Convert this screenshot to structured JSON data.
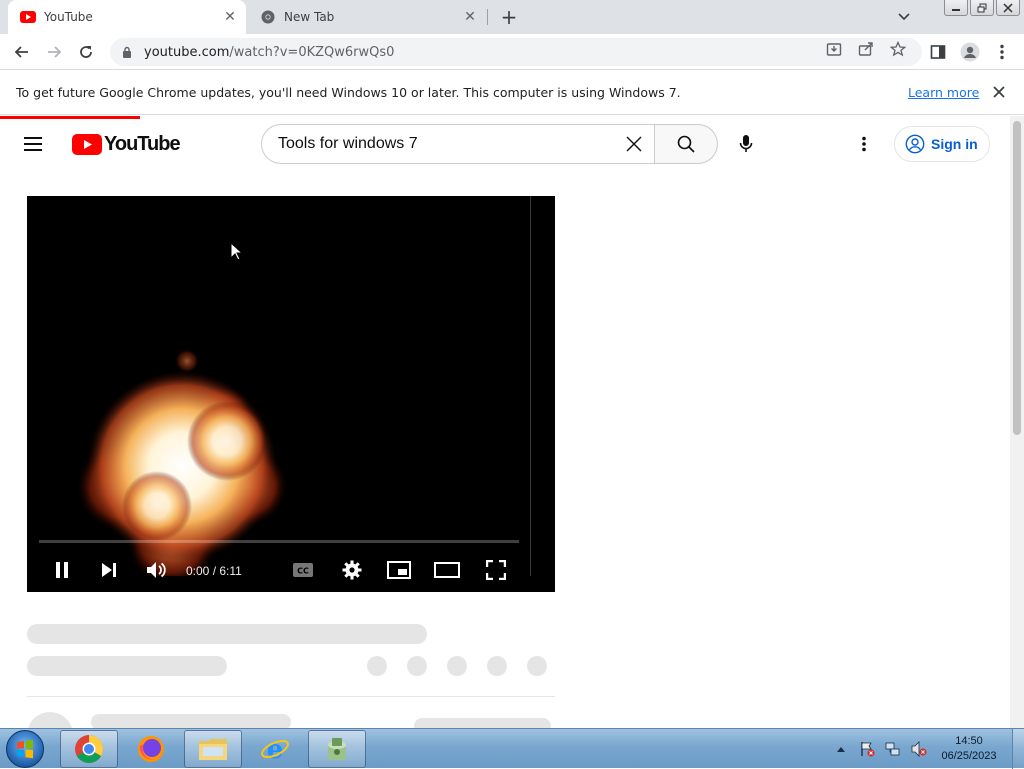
{
  "tabs": [
    {
      "title": "YouTube",
      "icon": "youtube-favicon"
    },
    {
      "title": "New Tab",
      "icon": "chrome-favicon"
    }
  ],
  "toolbar": {
    "url_host": "youtube.com",
    "url_path": "/watch?v=0KZQw6rwQs0"
  },
  "infobar": {
    "message": "To get future Google Chrome updates, you'll need Windows 10 or later. This computer is using Windows 7.",
    "learn_more": "Learn more"
  },
  "youtube": {
    "logo_text": "YouTube",
    "search_query": "Tools for windows 7",
    "sign_in": "Sign in"
  },
  "player": {
    "time": "0:00 / 6:11",
    "progress": 0.0
  },
  "taskbar": {
    "apps": [
      "chrome",
      "firefox",
      "file-explorer",
      "internet-explorer",
      "app-installer"
    ],
    "time": "14:50",
    "date": "06/25/2023"
  },
  "colors": {
    "youtube_red": "#ff0000",
    "link_blue": "#1a73e8",
    "signin_blue": "#065fd4"
  }
}
